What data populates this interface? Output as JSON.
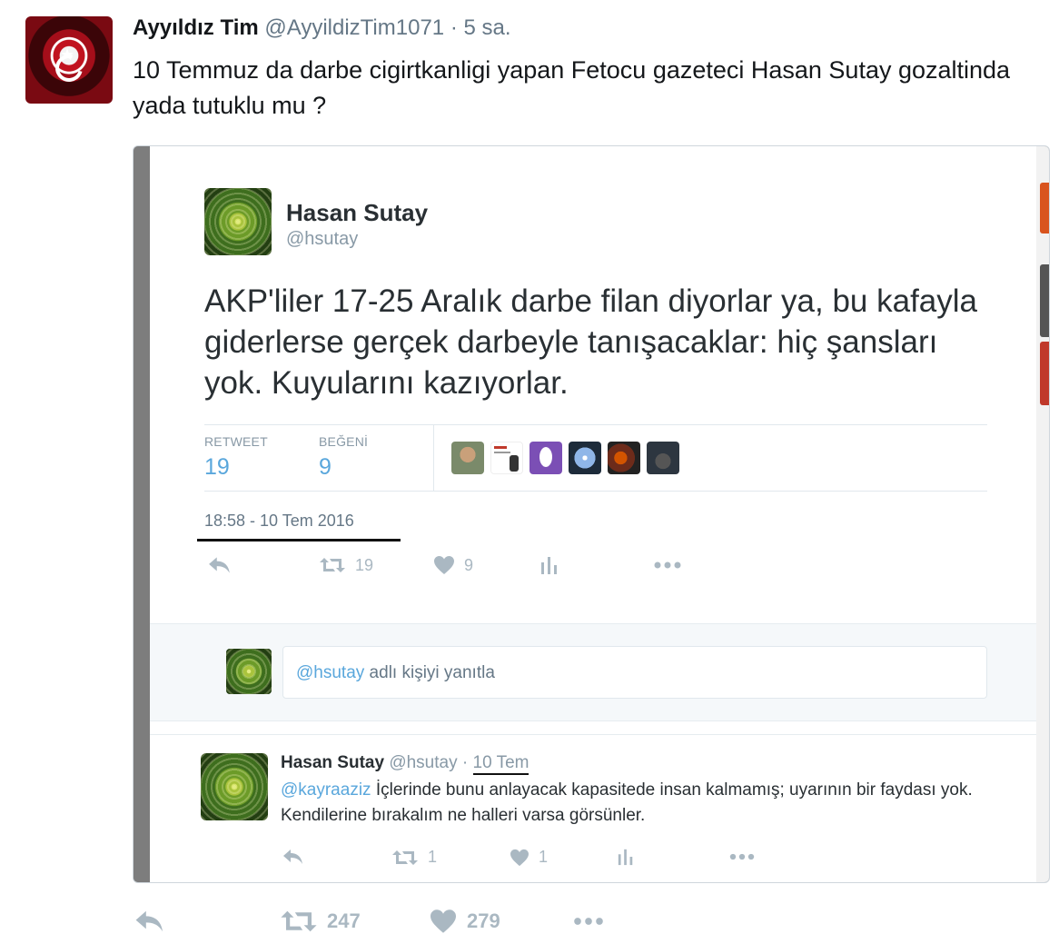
{
  "tweet": {
    "author_name": "Ayyıldız Tim",
    "author_handle": "@AyyildizTim1071",
    "time": "· 5 sa.",
    "text": "10 Temmuz da darbe cigirtkanligi yapan Fetocu gazeteci Hasan Sutay gozaltinda yada tutuklu mu ?",
    "retweet_count": "247",
    "like_count": "279"
  },
  "embedded": {
    "author_name": "Hasan Sutay",
    "author_handle": "@hsutay",
    "text": "AKP'liler 17-25 Aralık darbe filan diyorlar ya, bu kafayla giderlerse gerçek darbeyle tanışacaklar: hiç şansları yok. Kuyularını kazıyorlar.",
    "stats": {
      "retweet_label": "RETWEET",
      "retweet_value": "19",
      "like_label": "BEĞENİ",
      "like_value": "9"
    },
    "date": "18:58 - 10 Tem 2016",
    "action_retweet_count": "19",
    "action_like_count": "9",
    "reply_box": {
      "mention": "@hsutay",
      "placeholder_rest": " adlı kişiyi yanıtla"
    },
    "reply": {
      "author_name": "Hasan Sutay",
      "author_handle": "@hsutay",
      "separator": " · ",
      "time": "10 Tem",
      "mention": "@kayraaziz",
      "text": " İçlerinde bunu anlayacak kapasitede insan kalmamış; uyarının bir faydası yok. Kendilerine bırakalım ne halleri varsa görsünler.",
      "retweet_count": "1",
      "like_count": "1"
    }
  },
  "icons": [
    "reply-icon",
    "retweet-icon",
    "heart-icon",
    "analytics-icon",
    "more-icon"
  ],
  "colors": {
    "link": "#5aa7dc",
    "muted": "#aab8c2",
    "text": "#14171a"
  }
}
